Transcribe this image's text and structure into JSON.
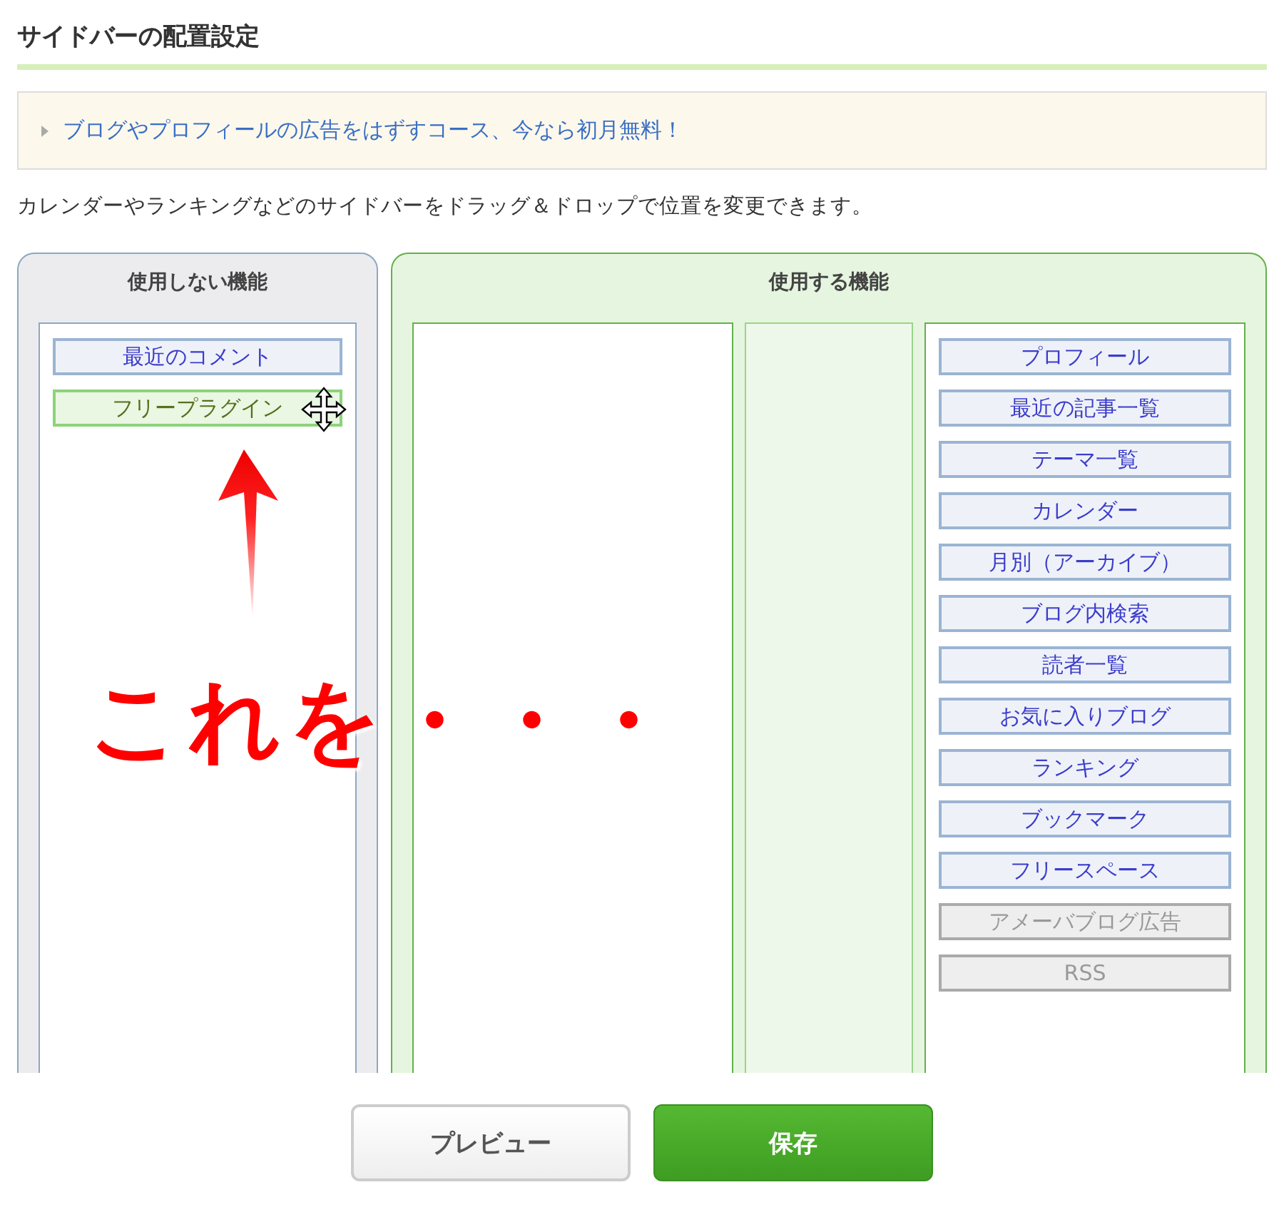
{
  "title": "サイドバーの配置設定",
  "notice": {
    "link": "ブログやプロフィールの広告をはずすコース、今なら初月無料！"
  },
  "description": "カレンダーやランキングなどのサイドバーをドラッグ＆ドロップで位置を変更できます。",
  "unused_panel": {
    "heading": "使用しない機能",
    "items": [
      {
        "label": "最近のコメント",
        "kind": "normal"
      },
      {
        "label": "フリープラグイン",
        "kind": "dragging"
      }
    ]
  },
  "used_panel": {
    "heading": "使用する機能",
    "columns": [
      {
        "kind": "wide"
      },
      {
        "kind": "narrow"
      },
      {
        "kind": "wide",
        "items": [
          {
            "label": "プロフィール",
            "kind": "normal"
          },
          {
            "label": "最近の記事一覧",
            "kind": "normal"
          },
          {
            "label": "テーマ一覧",
            "kind": "normal"
          },
          {
            "label": "カレンダー",
            "kind": "normal"
          },
          {
            "label": "月別（アーカイブ）",
            "kind": "normal"
          },
          {
            "label": "ブログ内検索",
            "kind": "normal"
          },
          {
            "label": "読者一覧",
            "kind": "normal"
          },
          {
            "label": "お気に入りブログ",
            "kind": "normal"
          },
          {
            "label": "ランキング",
            "kind": "normal"
          },
          {
            "label": "ブックマーク",
            "kind": "normal"
          },
          {
            "label": "フリースペース",
            "kind": "normal"
          },
          {
            "label": "アメーバブログ広告",
            "kind": "disabled"
          },
          {
            "label": "RSS",
            "kind": "disabled"
          }
        ]
      }
    ]
  },
  "annotation": {
    "text": "これを・・・"
  },
  "buttons": [
    {
      "label": "プレビュー",
      "kind": "secondary"
    },
    {
      "label": "保存",
      "kind": "primary"
    }
  ]
}
